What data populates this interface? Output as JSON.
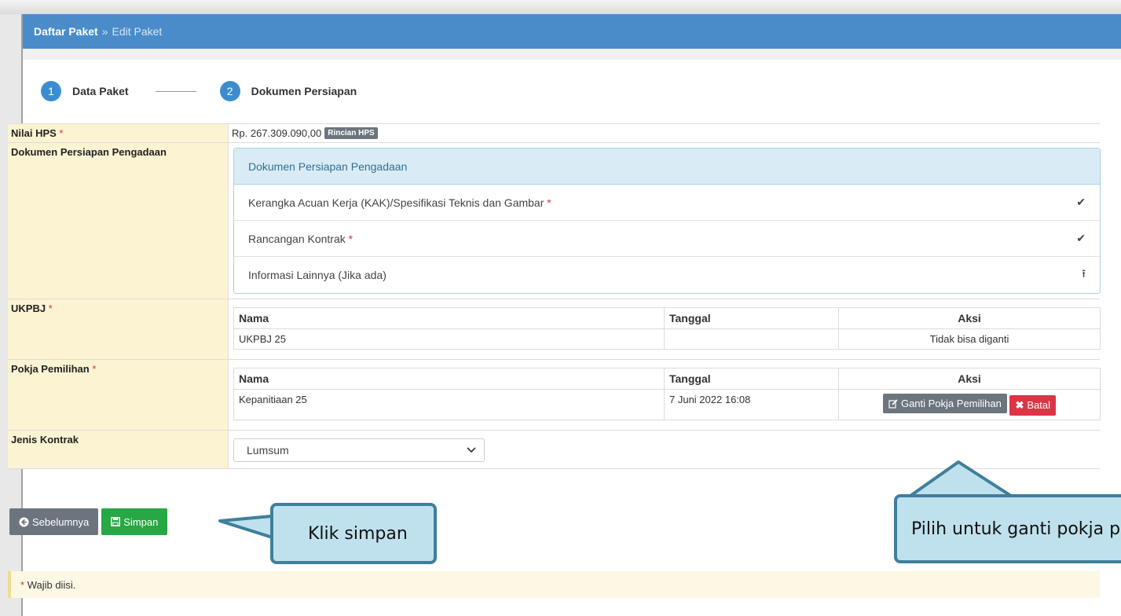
{
  "breadcrumb": {
    "root": "Daftar Paket",
    "separator": "»",
    "current": "Edit Paket"
  },
  "steps": [
    {
      "num": "1",
      "label": "Data Paket"
    },
    {
      "num": "2",
      "label": "Dokumen Persiapan"
    }
  ],
  "hps": {
    "label": "Nilai HPS",
    "required": "*",
    "value": "Rp. 267.309.090,00",
    "badge": "Rincian HPS"
  },
  "dokumen": {
    "label": "Dokumen Persiapan Pengadaan",
    "panel_title": "Dokumen Persiapan Pengadaan",
    "items": [
      {
        "text": "Kerangka Acuan Kerja (KAK)/Spesifikasi Teknis dan Gambar",
        "required": "*",
        "icon": "check-icon",
        "glyph": "✔"
      },
      {
        "text": "Rancangan Kontrak",
        "required": "*",
        "icon": "check-icon",
        "glyph": "✔"
      },
      {
        "text": "Informasi Lainnya (Jika ada)",
        "required": "",
        "icon": "upload-icon",
        "glyph": "⭱"
      }
    ]
  },
  "ukpbj": {
    "label": "UKPBJ",
    "required": "*",
    "headers": [
      "Nama",
      "Tanggal",
      "Aksi"
    ],
    "row": {
      "nama": "UKPBJ 25",
      "tanggal": "",
      "aksi": "Tidak bisa diganti"
    }
  },
  "pokja": {
    "label": "Pokja Pemilihan",
    "required": "*",
    "headers": [
      "Nama",
      "Tanggal",
      "Aksi"
    ],
    "row": {
      "nama": "Kepanitiaan 25",
      "tanggal": "7 Juni 2022 16:08"
    },
    "ganti_label": "Ganti Pokja Pemilihan",
    "batal_label": "Batal"
  },
  "jenis_kontrak": {
    "label": "Jenis Kontrak",
    "selected": "Lumsum"
  },
  "buttons": {
    "prev": "Sebelumnya",
    "save": "Simpan"
  },
  "notice": {
    "star": "*",
    "text": "Wajib diisi."
  },
  "callouts": {
    "save": "Klik simpan",
    "pokja": "Pilih untuk ganti pokja pe"
  },
  "colors": {
    "header": "#4a8cc9",
    "label_bg": "#fcf3d3",
    "callout_bg": "#bfe1ed",
    "callout_border": "#3f7f9b"
  }
}
